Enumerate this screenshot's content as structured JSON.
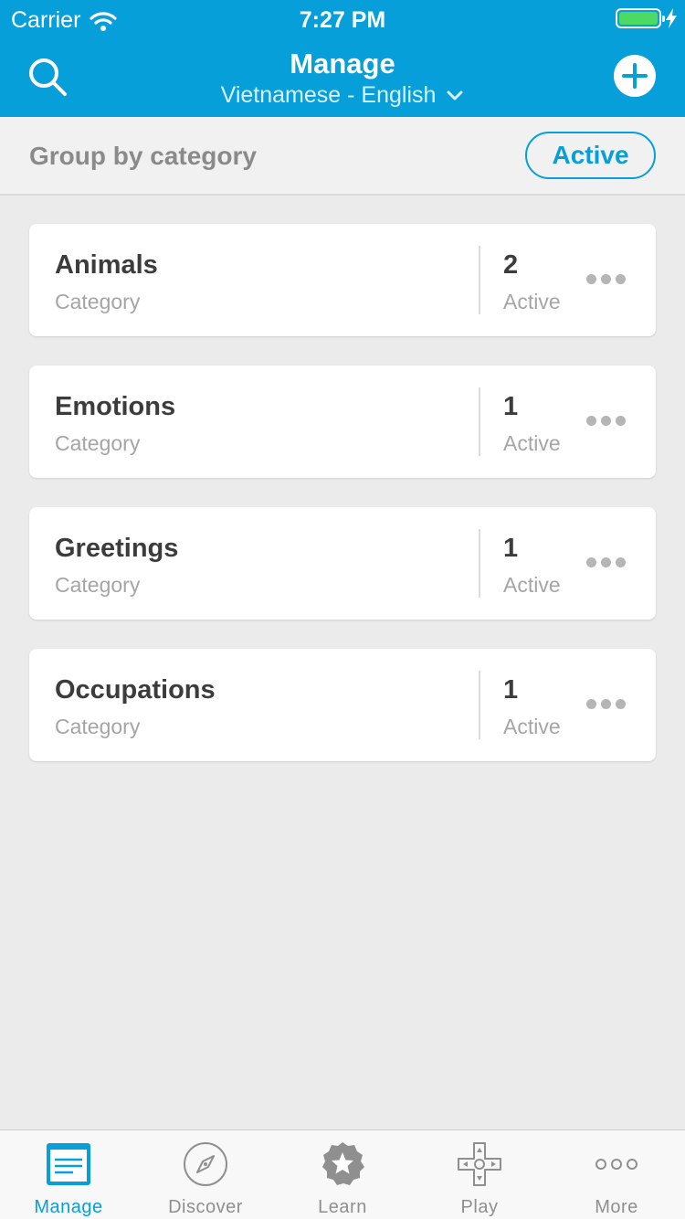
{
  "status_bar": {
    "carrier": "Carrier",
    "time": "7:27 PM"
  },
  "header": {
    "title": "Manage",
    "language_pair": "Vietnamese - English"
  },
  "group_bar": {
    "label": "Group by category",
    "filter_label": "Active"
  },
  "categories": [
    {
      "name": "Animals",
      "type": "Category",
      "count": "2",
      "status": "Active"
    },
    {
      "name": "Emotions",
      "type": "Category",
      "count": "1",
      "status": "Active"
    },
    {
      "name": "Greetings",
      "type": "Category",
      "count": "1",
      "status": "Active"
    },
    {
      "name": "Occupations",
      "type": "Category",
      "count": "1",
      "status": "Active"
    }
  ],
  "tabs": [
    {
      "label": "Manage",
      "icon": "manage-icon",
      "selected": true
    },
    {
      "label": "Discover",
      "icon": "compass-icon",
      "selected": false
    },
    {
      "label": "Learn",
      "icon": "star-badge-icon",
      "selected": false
    },
    {
      "label": "Play",
      "icon": "gamepad-icon",
      "selected": false
    },
    {
      "label": "More",
      "icon": "more-dots-icon",
      "selected": false
    }
  ],
  "colors": {
    "brand": "#069fd9",
    "battery": "#4cd964",
    "background": "#ebebeb"
  }
}
